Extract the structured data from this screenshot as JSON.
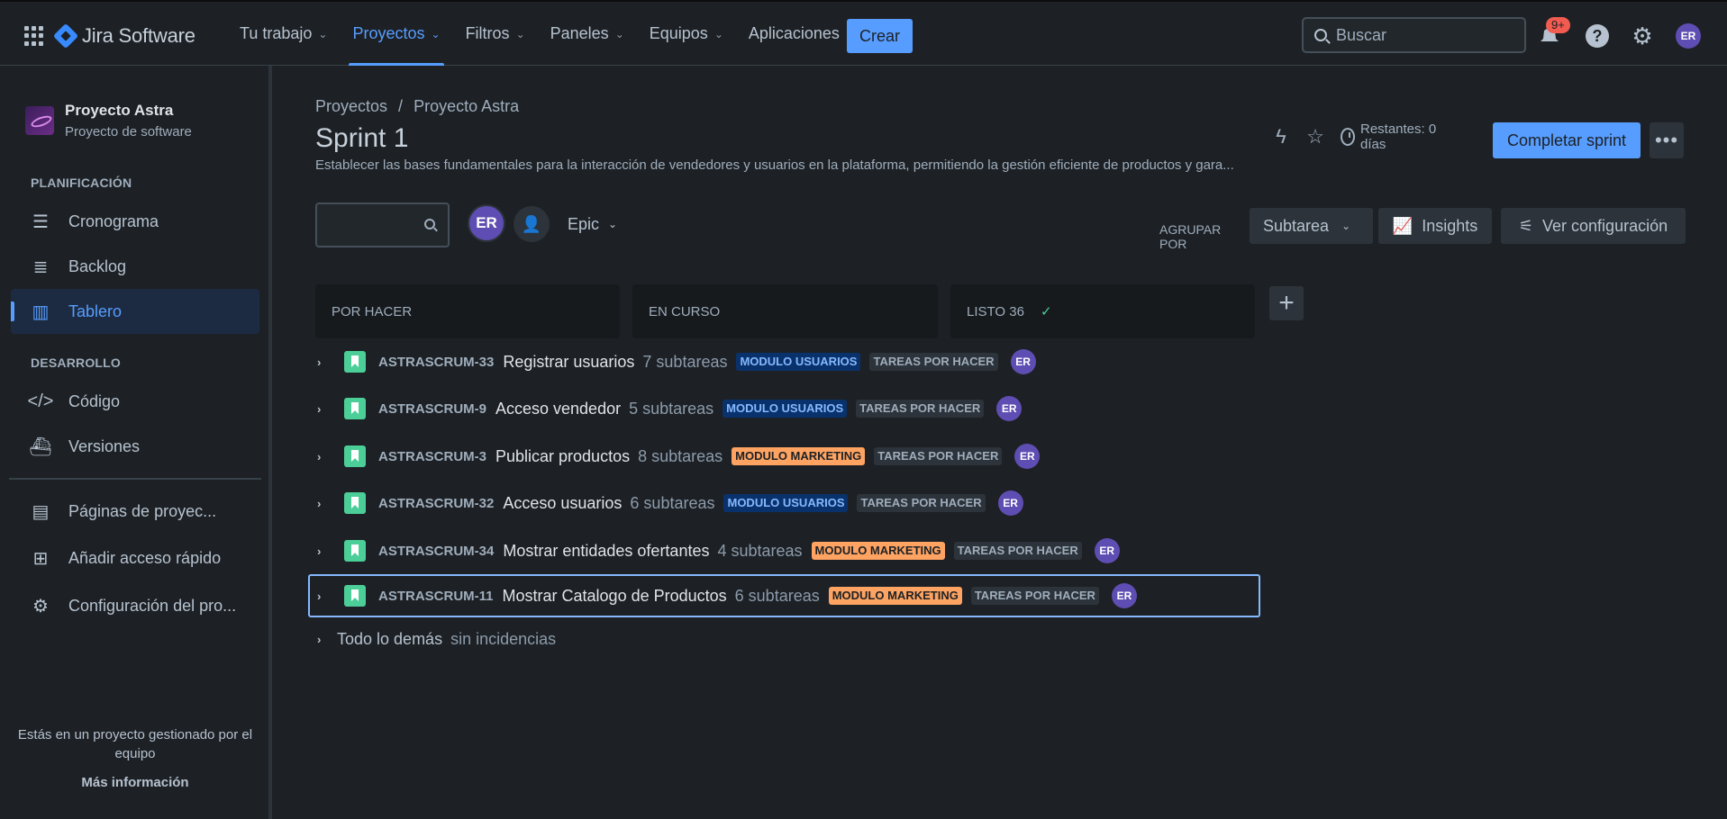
{
  "topbar": {
    "product_name": "Jira Software",
    "nav": [
      {
        "label": "Tu trabajo"
      },
      {
        "label": "Proyectos"
      },
      {
        "label": "Filtros"
      },
      {
        "label": "Paneles"
      },
      {
        "label": "Equipos"
      },
      {
        "label": "Aplicaciones"
      }
    ],
    "create_label": "Crear",
    "search_placeholder": "Buscar",
    "notifications_badge": "9+",
    "avatar_initials": "ER"
  },
  "sidebar": {
    "project_name": "Proyecto Astra",
    "project_type": "Proyecto de software",
    "planning_title": "PLANIFICACIÓN",
    "planning_items": [
      {
        "label": "Cronograma",
        "icon": "timeline-icon"
      },
      {
        "label": "Backlog",
        "icon": "backlog-icon"
      },
      {
        "label": "Tablero",
        "icon": "board-icon"
      }
    ],
    "dev_title": "DESARROLLO",
    "dev_items": [
      {
        "label": "Código",
        "icon": "code-icon"
      },
      {
        "label": "Versiones",
        "icon": "releases-icon"
      }
    ],
    "extra_items": [
      {
        "label": "Páginas de proyec...",
        "icon": "pages-icon"
      },
      {
        "label": "Añadir acceso rápido",
        "icon": "add-shortcut-icon"
      },
      {
        "label": "Configuración del pro...",
        "icon": "settings-icon"
      }
    ],
    "footer_text": "Estás en un proyecto gestionado por el equipo",
    "footer_link": "Más información"
  },
  "main": {
    "breadcrumb": [
      "Proyectos",
      "Proyecto Astra"
    ],
    "breadcrumb_sep": "/",
    "title": "Sprint 1",
    "description": "Establecer las bases fundamentales para la interacción de vendedores y usuarios en la plataforma, permitiendo la gestión eficiente de productos y gara...",
    "remaining": "Restantes: 0 días",
    "complete_label": "Completar sprint",
    "more_label": "•••",
    "filter_avatar": "ER",
    "epic_label": "Epic",
    "group_by_label": "AGRUPAR POR",
    "group_by_value": "Subtarea",
    "insights_label": "Insights",
    "config_label": "Ver configuración"
  },
  "columns": [
    {
      "label": "POR HACER"
    },
    {
      "label": "EN CURSO"
    },
    {
      "label": "LISTO 36",
      "check": "✓"
    }
  ],
  "rows": [
    {
      "key": "ASTRASCRUM-33",
      "summary": "Registrar usuarios",
      "subtasks": "7 subtareas",
      "tag": "MODULO USUARIOS",
      "tag_type": "users",
      "status": "TAREAS POR HACER",
      "avatar": "ER"
    },
    {
      "key": "ASTRASCRUM-9",
      "summary": "Acceso vendedor",
      "subtasks": "5 subtareas",
      "tag": "MODULO USUARIOS",
      "tag_type": "users",
      "status": "TAREAS POR HACER",
      "avatar": "ER"
    },
    {
      "key": "ASTRASCRUM-3",
      "summary": "Publicar productos",
      "subtasks": "8 subtareas",
      "tag": "MODULO MARKETING",
      "tag_type": "marketing",
      "status": "TAREAS POR HACER",
      "avatar": "ER"
    },
    {
      "key": "ASTRASCRUM-32",
      "summary": "Acceso usuarios",
      "subtasks": "6 subtareas",
      "tag": "MODULO USUARIOS",
      "tag_type": "users",
      "status": "TAREAS POR HACER",
      "avatar": "ER"
    },
    {
      "key": "ASTRASCRUM-34",
      "summary": "Mostrar entidades ofertantes",
      "subtasks": "4 subtareas",
      "tag": "MODULO MARKETING",
      "tag_type": "marketing",
      "status": "TAREAS POR HACER",
      "avatar": "ER"
    },
    {
      "key": "ASTRASCRUM-11",
      "summary": "Mostrar Catalogo de Productos",
      "subtasks": "6 subtareas",
      "tag": "MODULO MARKETING",
      "tag_type": "marketing",
      "status": "TAREAS POR HACER",
      "avatar": "ER"
    }
  ],
  "rest_row": {
    "label": "Todo lo demás",
    "sub": "sin incidencias"
  },
  "colors": {
    "accent": "#579dff",
    "users_tag": "#09326c",
    "marketing_tag": "#fea362",
    "story": "#4bce97",
    "avatar": "#5e4db2"
  }
}
